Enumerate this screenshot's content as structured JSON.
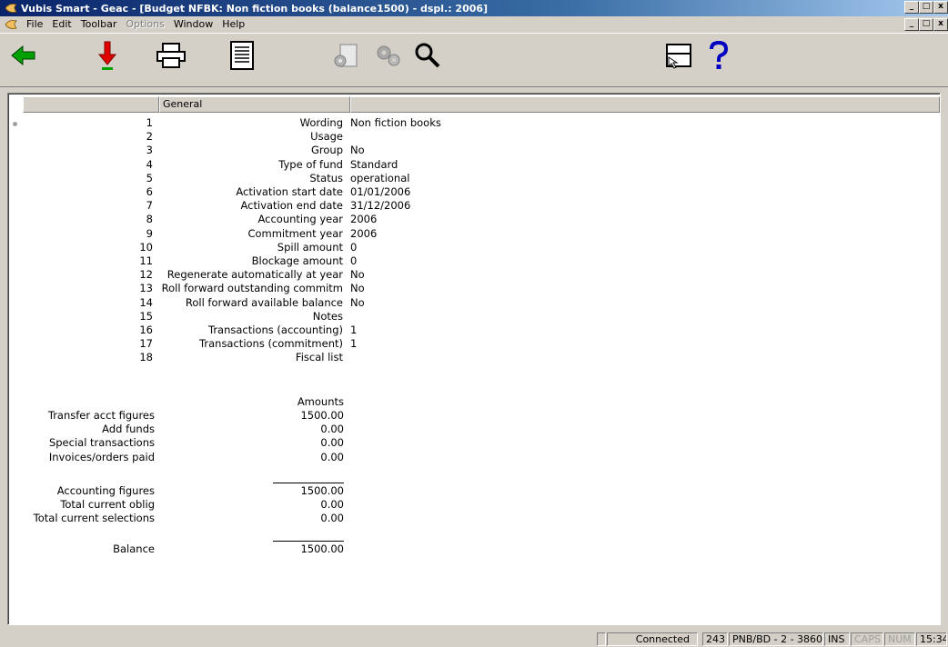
{
  "window": {
    "title": "Vubis Smart - Geac - [Budget NFBK: Non fiction books (balance1500) - dspl.: 2006]",
    "min_label": "_",
    "max_label": "□",
    "close_label": "x"
  },
  "menubar": {
    "items": [
      {
        "label": "File",
        "enabled": true
      },
      {
        "label": "Edit",
        "enabled": true
      },
      {
        "label": "Toolbar",
        "enabled": true
      },
      {
        "label": "Options",
        "enabled": false
      },
      {
        "label": "Window",
        "enabled": true
      },
      {
        "label": "Help",
        "enabled": true
      }
    ]
  },
  "toolbar": {
    "buttons": [
      {
        "icon": "back-arrow-icon",
        "color": "#00a000"
      },
      {
        "icon": "down-arrow-icon",
        "color": "#e00000"
      },
      {
        "icon": "printer-icon"
      },
      {
        "icon": "list-document-icon"
      },
      {
        "icon": "settings-disabled-icon"
      },
      {
        "icon": "gears-disabled-icon"
      },
      {
        "icon": "magnifier-icon"
      },
      {
        "icon": "window-pointer-icon"
      },
      {
        "icon": "help-question-icon",
        "color": "#0000c0"
      }
    ]
  },
  "grid": {
    "header": "General",
    "rows": [
      {
        "num": "1",
        "label": "Wording",
        "value": "Non fiction books"
      },
      {
        "num": "2",
        "label": "Usage",
        "value": ""
      },
      {
        "num": "3",
        "label": "Group",
        "value": "No"
      },
      {
        "num": "4",
        "label": "Type of fund",
        "value": "Standard"
      },
      {
        "num": "5",
        "label": "Status",
        "value": "operational"
      },
      {
        "num": "6",
        "label": "Activation start date",
        "value": "01/01/2006"
      },
      {
        "num": "7",
        "label": "Activation end date",
        "value": "31/12/2006"
      },
      {
        "num": "8",
        "label": "Accounting year",
        "value": "2006"
      },
      {
        "num": "9",
        "label": "Commitment year",
        "value": "2006"
      },
      {
        "num": "10",
        "label": "Spill amount",
        "value": "0"
      },
      {
        "num": "11",
        "label": "Blockage amount",
        "value": "0"
      },
      {
        "num": "12",
        "label": "Regenerate automatically at year",
        "value": "No"
      },
      {
        "num": "13",
        "label": "Roll forward outstanding commitm",
        "value": "No"
      },
      {
        "num": "14",
        "label": "Roll forward available balance",
        "value": "No"
      },
      {
        "num": "15",
        "label": "Notes",
        "value": ""
      },
      {
        "num": "16",
        "label": "Transactions (accounting)",
        "value": "1"
      },
      {
        "num": "17",
        "label": "Transactions (commitment)",
        "value": "1"
      },
      {
        "num": "18",
        "label": "Fiscal list",
        "value": ""
      }
    ],
    "amounts_header": "Amounts",
    "amounts_group1": [
      {
        "label": "Transfer acct figures",
        "value": "1500.00"
      },
      {
        "label": "Add funds",
        "value": "0.00"
      },
      {
        "label": "Special transactions",
        "value": "0.00"
      },
      {
        "label": "Invoices/orders paid",
        "value": "0.00"
      }
    ],
    "amounts_group2": [
      {
        "label": "Accounting figures",
        "value": "1500.00"
      },
      {
        "label": "Total current oblig",
        "value": "0.00"
      },
      {
        "label": "Total current selections",
        "value": "0.00"
      }
    ],
    "balance": {
      "label": "Balance",
      "value": "1500.00"
    }
  },
  "statusbar": {
    "connection": "Connected",
    "count": "243",
    "location": "PNB/BD - 2 - 3860",
    "ins": "INS",
    "caps": "CAPS",
    "num": "NUM",
    "time": "15:34"
  }
}
